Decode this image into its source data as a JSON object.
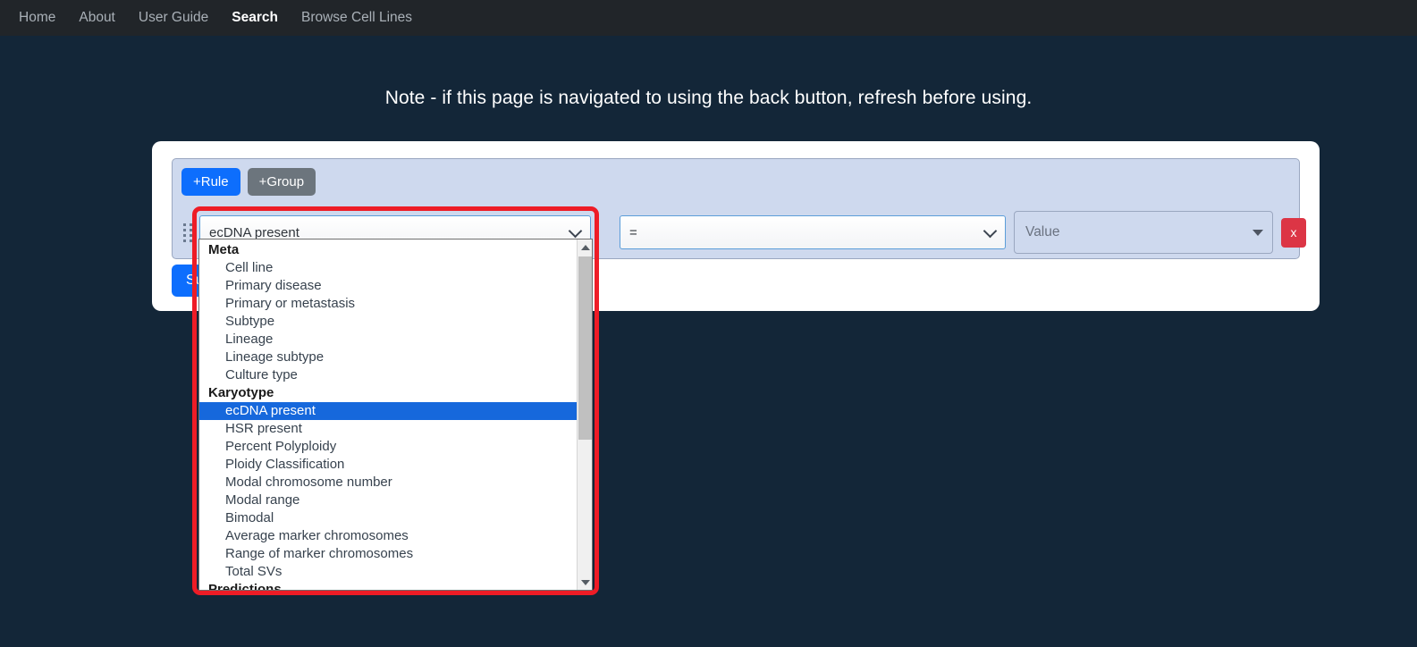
{
  "nav": {
    "items": [
      {
        "label": "Home",
        "active": false
      },
      {
        "label": "About",
        "active": false
      },
      {
        "label": "User Guide",
        "active": false
      },
      {
        "label": "Search",
        "active": true
      },
      {
        "label": "Browse Cell Lines",
        "active": false
      }
    ]
  },
  "page": {
    "note": "Note - if this page is navigated to using the back button, refresh before using."
  },
  "query_builder": {
    "add_rule_label": "+Rule",
    "add_group_label": "+Group",
    "submit_label": "Submit",
    "remove_rule_label": "x",
    "rule": {
      "field_value": "ecDNA present",
      "operator_value": "=",
      "value_placeholder": "Value"
    }
  },
  "dropdown": {
    "open": true,
    "selected": "ecDNA present",
    "groups": [
      {
        "label": "Meta",
        "options": [
          "Cell line",
          "Primary disease",
          "Primary or metastasis",
          "Subtype",
          "Lineage",
          "Lineage subtype",
          "Culture type"
        ]
      },
      {
        "label": "Karyotype",
        "options": [
          "ecDNA present",
          "HSR present",
          "Percent Polyploidy",
          "Ploidy Classification",
          "Modal chromosome number",
          "Modal range",
          "Bimodal",
          "Average marker chromosomes",
          "Range of marker chromosomes",
          "Total SVs"
        ]
      },
      {
        "label": "Predictions",
        "options": []
      }
    ]
  },
  "colors": {
    "nav_background": "#212529",
    "page_background": "#132638",
    "primary_button": "#0d6efd",
    "secondary_button": "#6c757d",
    "danger_button": "#dc3545",
    "panel_background": "#ced9ee",
    "highlight_ring": "#ee1c26",
    "dropdown_selected": "#1668dc"
  }
}
